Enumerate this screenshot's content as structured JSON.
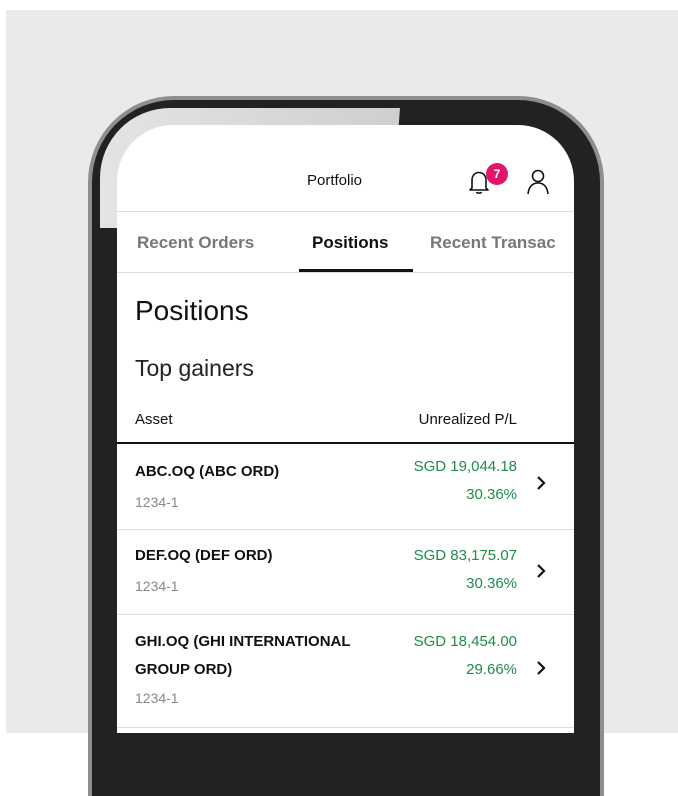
{
  "header": {
    "title": "Portfolio",
    "notification_count": "7"
  },
  "tabs": [
    {
      "label": "Recent Orders",
      "active": false
    },
    {
      "label": "Positions",
      "active": true
    },
    {
      "label": "Recent Transac",
      "active": false
    }
  ],
  "page": {
    "title": "Positions",
    "section_title": "Top gainers"
  },
  "table": {
    "columns": [
      "Asset",
      "Unrealized P/L"
    ],
    "rows": [
      {
        "asset": "ABC.OQ (ABC ORD)",
        "account": "1234-1",
        "amount": "SGD 19,044.18",
        "percent": "30.36%"
      },
      {
        "asset": "DEF.OQ (DEF ORD)",
        "account": "1234-1",
        "amount": "SGD 83,175.07",
        "percent": "30.36%"
      },
      {
        "asset_line1": "GHI.OQ (GHI INTERNATIONAL",
        "asset_line2": "GROUP ORD)",
        "account": "1234-1",
        "amount": "SGD 18,454.00",
        "percent": "29.66%"
      }
    ]
  },
  "colors": {
    "accent_badge": "#e0156b",
    "gain_green": "#1e8c48"
  },
  "icons": [
    "bell-icon",
    "user-icon",
    "chevron-right-icon"
  ]
}
